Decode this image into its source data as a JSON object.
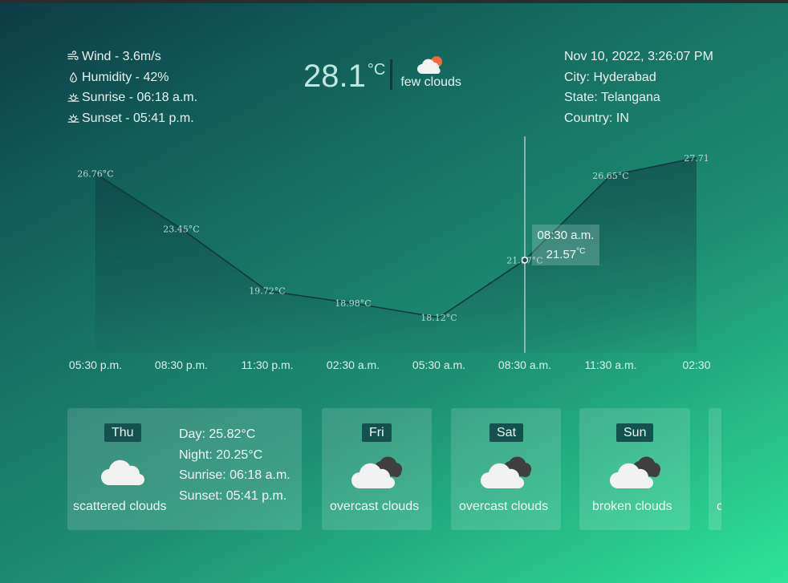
{
  "current": {
    "wind": "Wind - 3.6m/s",
    "humidity": "Humidity - 42%",
    "sunrise": "Sunrise - 06:18 a.m.",
    "sunset": "Sunset - 05:41 p.m.",
    "temp": "28.1",
    "unit": "°C",
    "condition": "few clouds",
    "datetime": "Nov 10, 2022, 3:26:07 PM",
    "city": "City: Hyderabad",
    "state": "State: Telangana",
    "country": "Country: IN"
  },
  "chart_data": {
    "type": "area",
    "x": [
      "05:30 p.m.",
      "08:30 p.m.",
      "11:30 p.m.",
      "02:30 a.m.",
      "05:30 a.m.",
      "08:30 a.m.",
      "11:30 a.m.",
      "02:30"
    ],
    "values": [
      26.76,
      23.45,
      19.72,
      18.98,
      18.12,
      21.57,
      26.65,
      27.71
    ],
    "point_labels": [
      "26.76°C",
      "23.45°C",
      "19.72°C",
      "18.98°C",
      "18.12°C",
      "21.57°C",
      "26.65°C",
      "27.71"
    ],
    "ylim": [
      16,
      29
    ],
    "grid": false,
    "tooltip": {
      "time": "08:30 a.m.",
      "value": "21.57",
      "unit": "°C"
    }
  },
  "forecast": [
    {
      "day": "Thu",
      "desc": "scattered clouds",
      "icon": "cloud-icon",
      "day_temp": "Day: 25.82°C",
      "night_temp": "Night: 20.25°C",
      "sunrise": "Sunrise: 06:18 a.m.",
      "sunset": "Sunset: 05:41 p.m."
    },
    {
      "day": "Fri",
      "desc": "overcast clouds",
      "icon": "overcast-clouds-icon"
    },
    {
      "day": "Sat",
      "desc": "overcast clouds",
      "icon": "overcast-clouds-icon"
    },
    {
      "day": "Sun",
      "desc": "broken clouds",
      "icon": "broken-clouds-icon"
    },
    {
      "day": "",
      "desc": "c",
      "icon": ""
    }
  ],
  "colors": {
    "bg_start": "#0d3b45",
    "bg_end": "#2ee39a",
    "line": "#0f3a3f",
    "badge": "#14524e"
  }
}
